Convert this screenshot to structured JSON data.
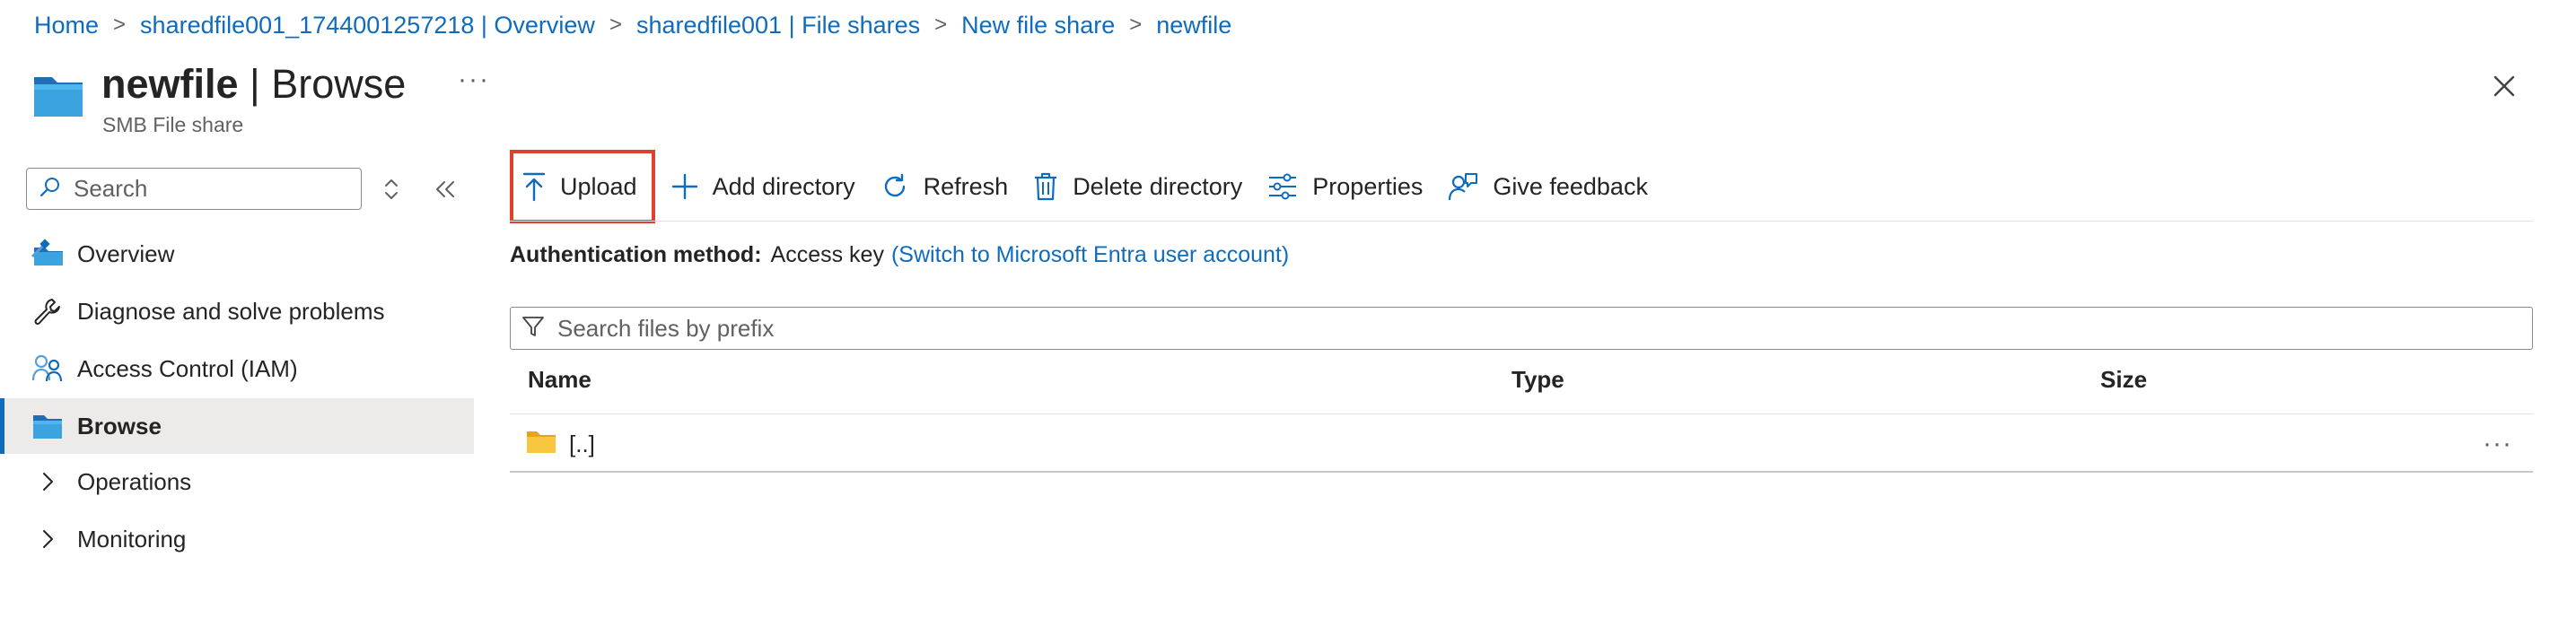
{
  "breadcrumb": {
    "items": [
      "Home",
      "sharedfile001_1744001257218 | Overview",
      "sharedfile001 | File shares",
      "New file share",
      "newfile"
    ]
  },
  "header": {
    "title_main": "newfile",
    "title_sep": " | ",
    "title_section": "Browse",
    "subtitle": "SMB File share",
    "more": "···"
  },
  "sidebar": {
    "search_placeholder": "Search",
    "items": [
      {
        "label": "Overview",
        "icon": "overview-icon"
      },
      {
        "label": "Diagnose and solve problems",
        "icon": "wrench-icon"
      },
      {
        "label": "Access Control (IAM)",
        "icon": "people-icon"
      },
      {
        "label": "Browse",
        "icon": "folder-icon",
        "active": true
      },
      {
        "label": "Operations",
        "icon": "chevron-right-icon"
      },
      {
        "label": "Monitoring",
        "icon": "chevron-right-icon"
      }
    ]
  },
  "toolbar": {
    "upload": "Upload",
    "add_directory": "Add directory",
    "refresh": "Refresh",
    "delete_directory": "Delete directory",
    "properties": "Properties",
    "give_feedback": "Give feedback"
  },
  "auth": {
    "label": "Authentication method:",
    "value": "Access key",
    "link": "(Switch to Microsoft Entra user account)"
  },
  "file_search": {
    "placeholder": "Search files by prefix"
  },
  "table": {
    "columns": [
      "Name",
      "Type",
      "Size"
    ],
    "rows": [
      {
        "name": "[..]",
        "type": "",
        "size": ""
      }
    ],
    "row_more": "···"
  },
  "colors": {
    "accent": "#0f6cbd",
    "highlight_border": "#e0412f",
    "active_nav_bg": "#edebe9"
  }
}
